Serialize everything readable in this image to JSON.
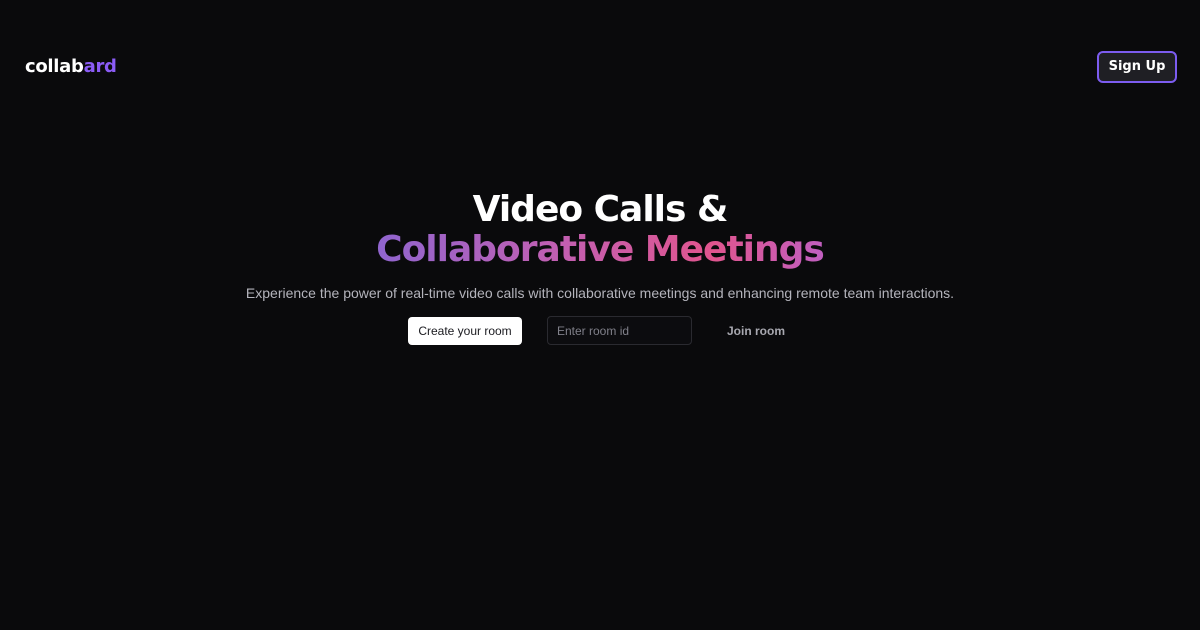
{
  "header": {
    "logo_part1": "collab",
    "logo_part2": "ard",
    "signup_label": "Sign Up"
  },
  "hero": {
    "title_line1": "Video Calls &",
    "title_line2": "Collaborative Meetings",
    "subtitle": "Experience the power of real-time video calls with collaborative meetings and enhancing remote team interactions."
  },
  "actions": {
    "create_label": "Create your room",
    "room_input_placeholder": "Enter room id",
    "room_input_value": "",
    "join_label": "Join room"
  },
  "colors": {
    "background": "#0a0a0c",
    "accent": "#8b5cf6",
    "gradient_start": "#9065cf",
    "gradient_end": "#e0558e"
  }
}
